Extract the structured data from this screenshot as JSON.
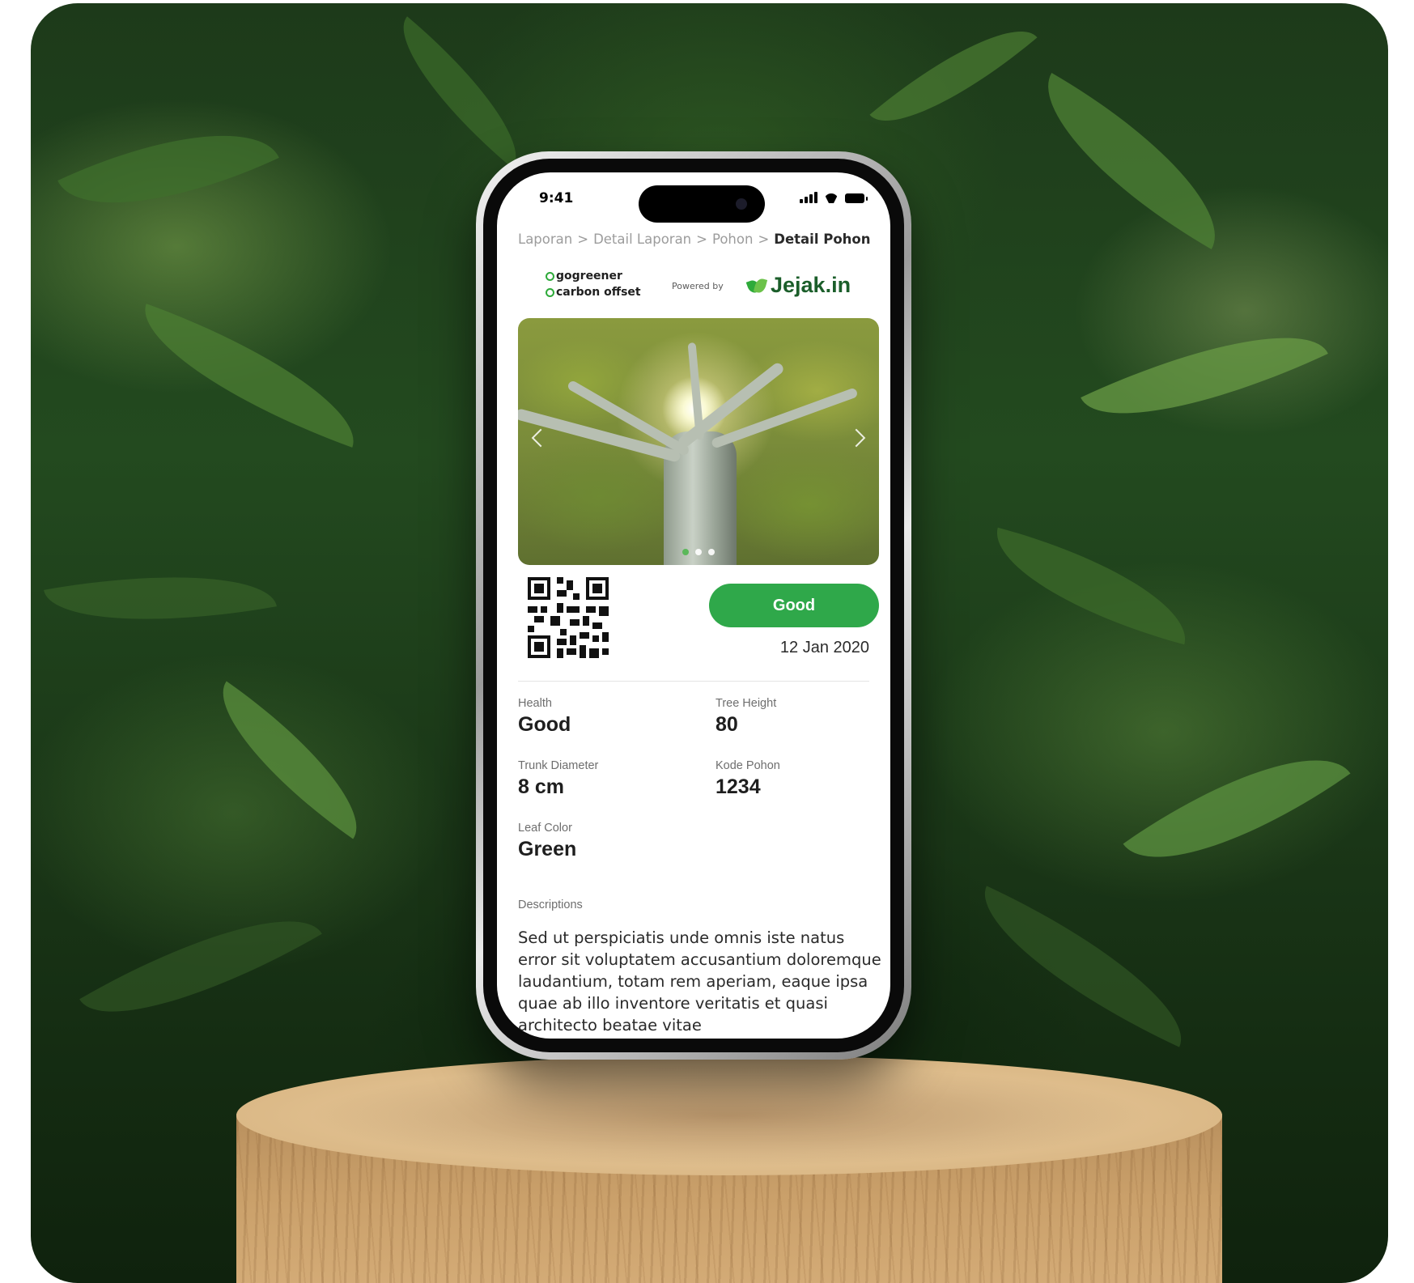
{
  "status_bar": {
    "time": "9:41"
  },
  "breadcrumb": {
    "items": [
      "Laporan",
      "Detail Laporan",
      "Pohon"
    ],
    "current": "Detail Pohon",
    "separator": ">"
  },
  "brand": {
    "left_logo_line1": "gogreener",
    "left_logo_line2": "carbon offset",
    "powered_by": "Powered by",
    "partner_name": "Jejak.in",
    "accent_color": "#2fa84a"
  },
  "photo": {
    "slides": 3,
    "active_slide": 1,
    "prev_icon": "chevron-left-icon",
    "next_icon": "chevron-right-icon"
  },
  "summary": {
    "status": "Good",
    "date": "12 Jan 2020"
  },
  "details": {
    "health": {
      "label": "Health",
      "value": "Good"
    },
    "tree_height": {
      "label": "Tree Height",
      "value": "80"
    },
    "trunk_diameter": {
      "label": "Trunk Diameter",
      "value": "8 cm"
    },
    "kode_pohon": {
      "label": "Kode Pohon",
      "value": "1234"
    },
    "leaf_color": {
      "label": "Leaf Color",
      "value": "Green"
    }
  },
  "descriptions": {
    "label": "Descriptions",
    "text": "Sed ut perspiciatis unde omnis iste natus error sit voluptatem accusantium doloremque laudantium, totam rem aperiam, eaque ipsa quae ab illo inventore veritatis et quasi architecto beatae vitae"
  }
}
